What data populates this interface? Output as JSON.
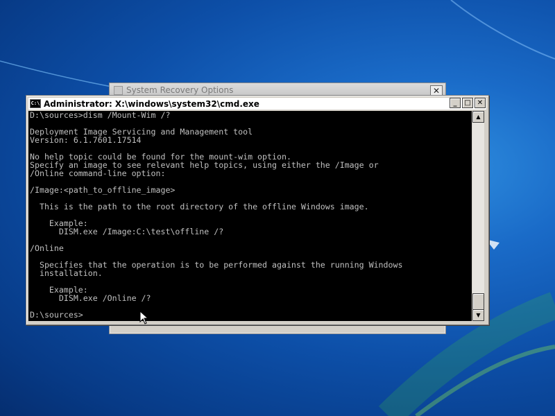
{
  "background_dialog": {
    "title": "System Recovery Options",
    "close_glyph": "✕"
  },
  "cmd_window": {
    "title": "Administrator: X:\\windows\\system32\\cmd.exe",
    "icon_text": "C:\\",
    "minimize_glyph": "_",
    "maximize_glyph": "□",
    "close_glyph": "✕",
    "lines": [
      "D:\\sources>dism /Mount-Wim /?",
      "",
      "Deployment Image Servicing and Management tool",
      "Version: 6.1.7601.17514",
      "",
      "No help topic could be found for the mount-wim option.",
      "Specify an image to see relevant help topics, using either the /Image or",
      "/Online command-line option:",
      "",
      "/Image:<path_to_offline_image>",
      "",
      "  This is the path to the root directory of the offline Windows image.",
      "",
      "    Example:",
      "      DISM.exe /Image:C:\\test\\offline /?",
      "",
      "/Online",
      "",
      "  Specifies that the operation is to be performed against the running Windows",
      "  installation.",
      "",
      "    Example:",
      "      DISM.exe /Online /?",
      "",
      "D:\\sources>"
    ],
    "scroll_up_glyph": "▲",
    "scroll_down_glyph": "▼",
    "text_color": "#c0c0c0",
    "console_bg": "#000000"
  },
  "theme": {
    "desktop_accent": "#1a6bc8"
  }
}
